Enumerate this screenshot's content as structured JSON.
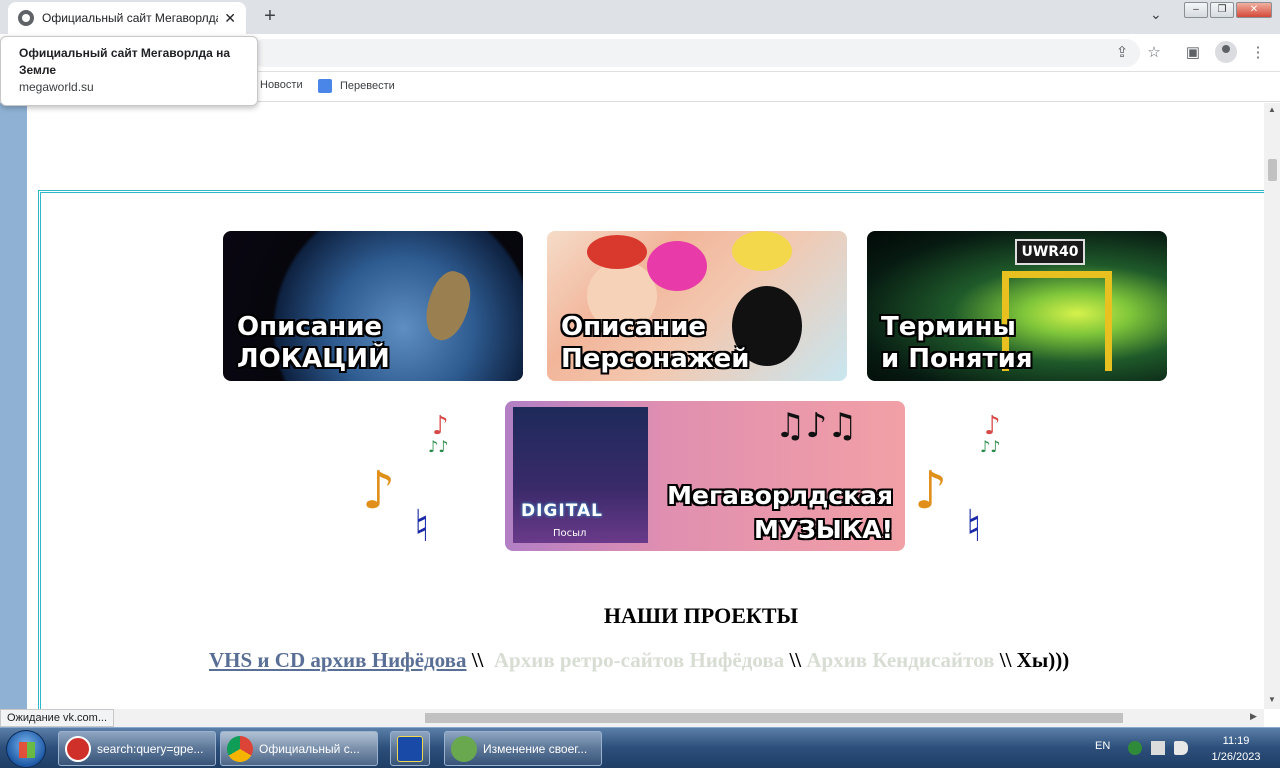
{
  "browser": {
    "tab_title": "Официальный сайт Мегаворлда на Земле",
    "tab_close": "✕",
    "new_tab": "+",
    "tab_search": "⌄",
    "win_min": "–",
    "win_max": "❐",
    "win_close": "✕"
  },
  "toolbar": {
    "share_icon": "share-icon",
    "star_icon": "star-icon",
    "sidepanel_icon": "side-panel-icon",
    "menu_icon": "kebab-menu-icon"
  },
  "bookmarks": {
    "items": [
      {
        "label": "Новости"
      },
      {
        "label": "Перевести"
      }
    ]
  },
  "tooltip": {
    "title": "Официальный сайт Мегаворлда на Земле",
    "url": "megaworld.su"
  },
  "page": {
    "banners": [
      {
        "line1": "Описание",
        "line2": "ЛОКАЦИЙ"
      },
      {
        "line1": "Описание",
        "line2": "Персонажей"
      },
      {
        "line1": "Термины",
        "line2": "и Понятия",
        "sign": "UWR40"
      }
    ],
    "music_banner": {
      "line1": "Мегаворлдская",
      "line2": "МУЗЫКА!",
      "cover_text": "DIGITAL",
      "cover_sub": "Посыл"
    },
    "projects_title": "НАШИ ПРОЕКТЫ",
    "links": [
      {
        "label": "VHS и CD архив Нифёдова"
      },
      {
        "label": "Архив ретро-сайтов Нифёдова"
      },
      {
        "label": "Архив Кендисайтов"
      }
    ],
    "separator": "\\\\",
    "tail": "Хы)))"
  },
  "status_bar": "Ожидание vk.com...",
  "taskbar": {
    "buttons": [
      {
        "label": "search:query=gpe..."
      },
      {
        "label": "Официальный с..."
      },
      {
        "label": ""
      },
      {
        "label": "Изменение своег..."
      }
    ],
    "lang": "EN",
    "time": "11:19",
    "date": "1/26/2023"
  },
  "colors": {
    "frame_border": "#2bb8c8",
    "link_visited": "#5a6f96",
    "link_faded": "#d7ddd3",
    "left_strip": "#8fb2d4"
  }
}
